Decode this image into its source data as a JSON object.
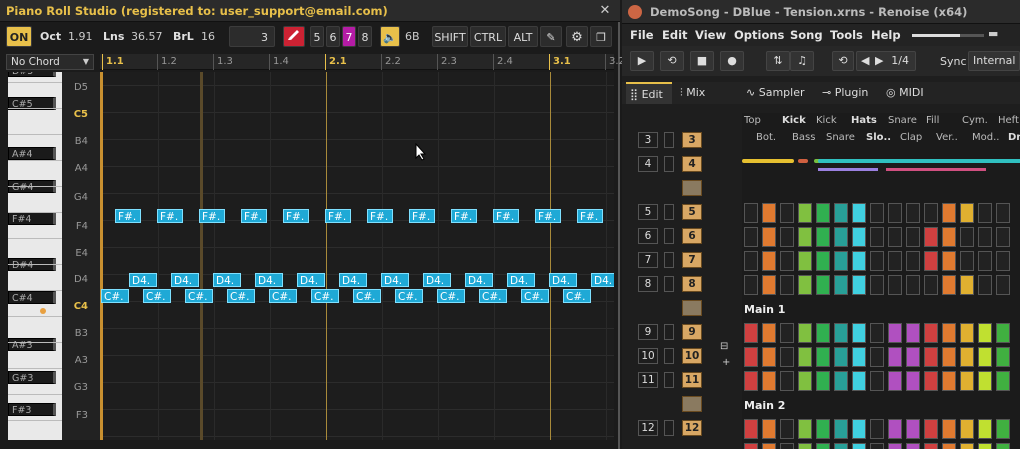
{
  "piano_roll": {
    "title": "Piano Roll Studio  (registered to: user_support@email.com)",
    "close": "✕",
    "toolbar": {
      "on_label": "ON",
      "oct_label": "Oct",
      "oct_value": "1.91",
      "lns_label": "Lns",
      "lns_value": "36.57",
      "brl_label": "BrL",
      "brl_value": "16",
      "step_value": "3",
      "divs": [
        "5",
        "6",
        "7",
        "8"
      ],
      "div_selected": "7",
      "vol_value": "6B",
      "shift_label": "SHIFT",
      "ctrl_label": "CTRL",
      "alt_label": "ALT"
    },
    "chord_select": "No Chord",
    "ruler": [
      "1.1",
      "1.2",
      "1.3",
      "1.4",
      "2.1",
      "2.2",
      "2.3",
      "2.4",
      "3.1",
      "3.2",
      "3"
    ],
    "key_labels": [
      "D#5",
      "C#5",
      "A#4",
      "G#4",
      "F#4",
      "D#4",
      "C#4",
      "A#3",
      "G#3",
      "F#3"
    ],
    "note_labels": [
      "D5",
      "C5",
      "B4",
      "A4",
      "G4",
      "F4",
      "E4",
      "D4",
      "C4",
      "B3",
      "A3",
      "G3",
      "F3"
    ],
    "notes": {
      "fsharp": "F#.",
      "d": "D4.",
      "csharp": "C#."
    },
    "colors": {
      "accent": "#e8c04a",
      "note": "#1fa9d6",
      "on": "#e8c04a"
    }
  },
  "renoise": {
    "title": "DemoSong - DBlue - Tension.xrns - Renoise (x64)",
    "menu": [
      "File",
      "Edit",
      "View",
      "Options",
      "Song",
      "Tools",
      "Help"
    ],
    "transport": {
      "lines_per_beat": "1/4",
      "sync_label": "Sync",
      "sync_value": "Internal"
    },
    "tabs": [
      "Edit",
      "Mix",
      "Sampler",
      "Plugin",
      "MIDI"
    ],
    "track_top": [
      "Top",
      "Kick",
      "Kick",
      "Hats",
      "Snare",
      "Fill",
      "Cym.",
      "Heft"
    ],
    "track_bottom": [
      "Bot.",
      "Bass",
      "Snare",
      "Slo..",
      "Clap",
      "Ver..",
      "Mod..",
      "Dr"
    ],
    "sections": [
      "Main 1",
      "Main 2"
    ],
    "pattern_numbers": [
      "3",
      "4",
      "5",
      "6",
      "7",
      "8",
      "9",
      "10",
      "11",
      "12"
    ],
    "pattern_pills": [
      "3",
      "4",
      "",
      "5",
      "6",
      "7",
      "8",
      "",
      "9",
      "10",
      "11",
      "",
      "12"
    ]
  }
}
